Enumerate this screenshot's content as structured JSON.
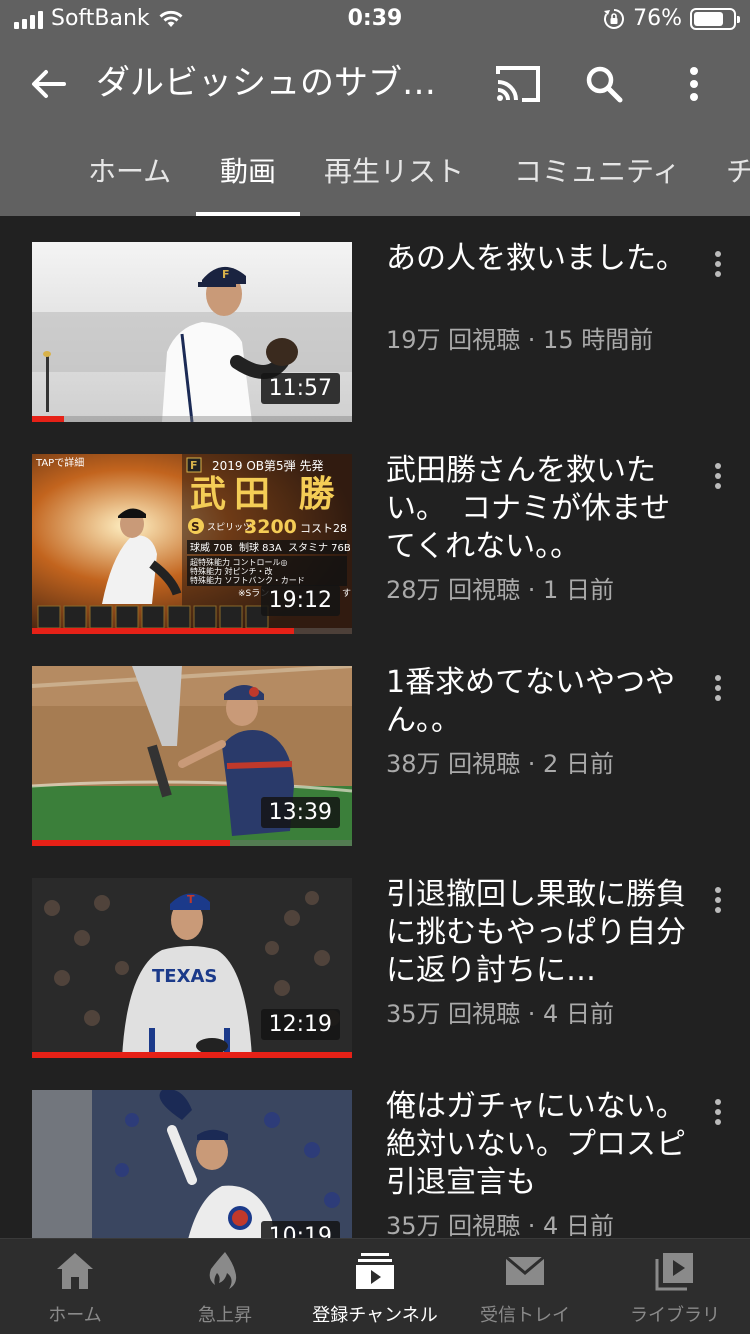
{
  "status_bar": {
    "carrier": "SoftBank",
    "time": "0:39",
    "battery_percent": "76%",
    "battery_level": 0.76
  },
  "app_bar": {
    "title": "ダルビッシュのサブ…",
    "icons": [
      "back-arrow-icon",
      "cast-icon",
      "search-icon",
      "more-vert-icon"
    ]
  },
  "tabs": [
    {
      "label": "ホーム"
    },
    {
      "label": "動画",
      "active": true
    },
    {
      "label": "再生リスト"
    },
    {
      "label": "コミュニティ"
    },
    {
      "label": "チ"
    }
  ],
  "videos": [
    {
      "title": "あの人を救いました。",
      "meta": "19万 回視聴 · 15 時間前",
      "duration": "11:57",
      "watched_fraction": 0.1
    },
    {
      "title": "武田勝さんを救いたい。　コナミが休ませてくれない。。",
      "meta": "28万 回視聴 · 1 日前",
      "duration": "19:12",
      "watched_fraction": 0.82,
      "thumb_text": {
        "tag": "TAPで詳細",
        "banner": "2019 OB第5弾 先発",
        "name": "武田 勝",
        "grade": "S",
        "grade_label": "スピリッツ",
        "spirit": "3200",
        "cost": "コスト28",
        "stat1": "球威 70B",
        "stat2": "制球 83A",
        "stat3": "スタミナ 76B",
        "ability1": "超特殊能力 コントロール◎",
        "ability2": "特殊能力 対ピンチ・改",
        "ability3": "特殊能力 ソフトバンク・カード",
        "rank": "※Sラン",
        "rank_tail": "す"
      }
    },
    {
      "title": "1番求めてないやつやん。。",
      "meta": "38万 回視聴 · 2 日前",
      "duration": "13:39",
      "watched_fraction": 0.62
    },
    {
      "title": "引退撤回し果敢に勝負に挑むもやっぱり自分に返り討ちに…",
      "meta": "35万 回視聴 · 4 日前",
      "duration": "12:19",
      "watched_fraction": 1.0,
      "thumb_text": {
        "jersey": "TEXAS",
        "cap": "T"
      }
    },
    {
      "title": "俺はガチャにいない。絶対いない。プロスピ引退宣言も",
      "meta": "35万 回視聴 · 4 日前",
      "duration": "10:19",
      "watched_fraction": 0
    }
  ],
  "bottom_nav": [
    {
      "label": "ホーム",
      "icon": "home-icon"
    },
    {
      "label": "急上昇",
      "icon": "flame-icon"
    },
    {
      "label": "登録チャンネル",
      "icon": "subscriptions-icon",
      "active": true
    },
    {
      "label": "受信トレイ",
      "icon": "mail-icon"
    },
    {
      "label": "ライブラリ",
      "icon": "library-icon"
    }
  ]
}
